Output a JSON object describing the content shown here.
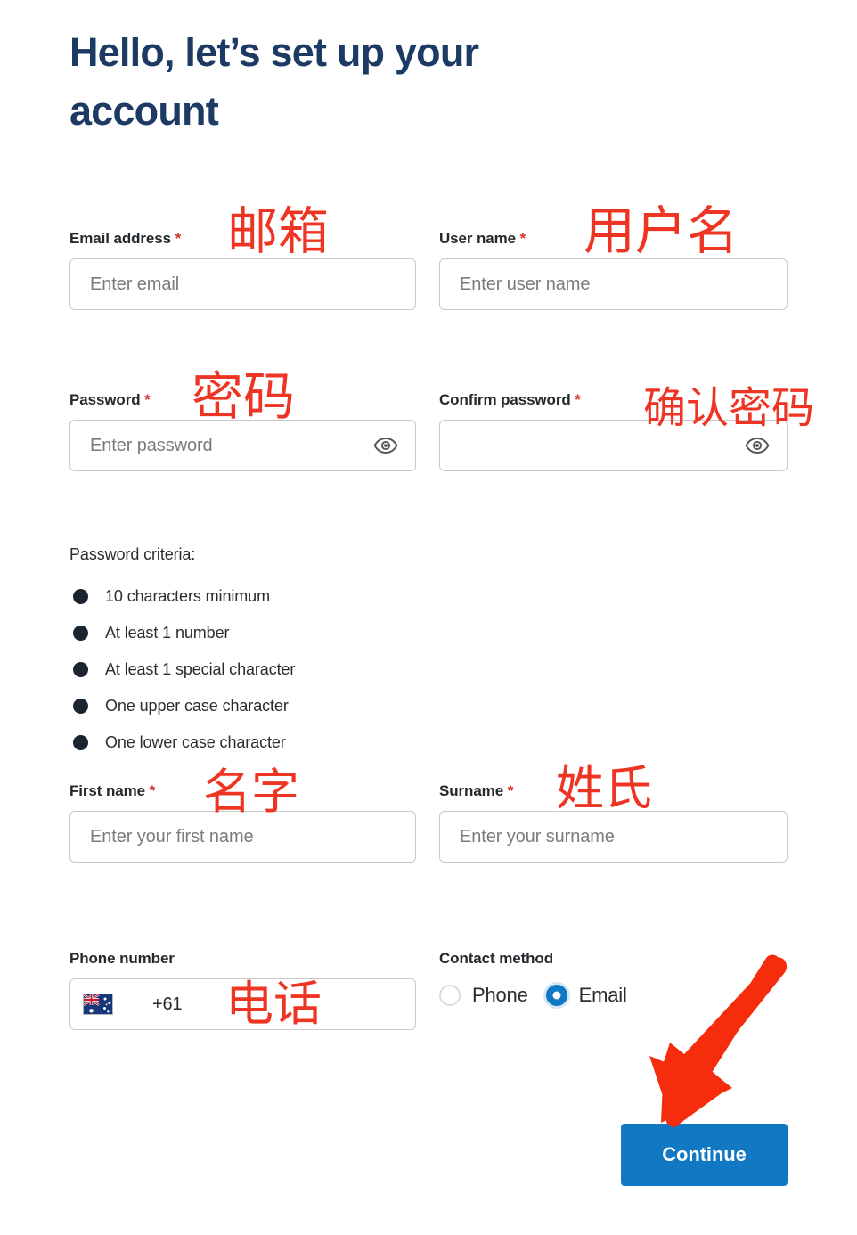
{
  "heading": "Hello, let’s set up your account",
  "fields": {
    "email": {
      "label": "Email address",
      "required_mark": "*",
      "placeholder": "Enter email",
      "annotation": "邮箱"
    },
    "username": {
      "label": "User name",
      "required_mark": "*",
      "placeholder": "Enter user name",
      "annotation": "用户名"
    },
    "password": {
      "label": "Password",
      "required_mark": "*",
      "placeholder": "Enter password",
      "annotation": "密码",
      "icon": "eye-icon"
    },
    "confirm": {
      "label": "Confirm password",
      "required_mark": "*",
      "placeholder": "",
      "annotation": "确认密码",
      "icon": "eye-icon"
    },
    "first_name": {
      "label": "First name",
      "required_mark": "*",
      "placeholder": "Enter your first name",
      "annotation": "名字"
    },
    "surname": {
      "label": "Surname",
      "required_mark": "*",
      "placeholder": "Enter your surname",
      "annotation": "姓氏"
    },
    "phone": {
      "label": "Phone number",
      "required_mark": "",
      "dial_code": "+61",
      "flag": "australia-flag-icon",
      "annotation": "电话"
    }
  },
  "password_criteria": {
    "title": "Password criteria:",
    "items": [
      "10 characters minimum",
      "At least 1 number",
      "At least 1 special character",
      "One upper case character",
      "One lower case character"
    ]
  },
  "contact_method": {
    "label": "Contact method",
    "options": [
      {
        "label": "Phone",
        "selected": false
      },
      {
        "label": "Email",
        "selected": true
      }
    ]
  },
  "actions": {
    "continue_label": "Continue"
  },
  "colors": {
    "heading": "#1c3a63",
    "primary_blue": "#1178c4",
    "annotation_red": "#ee3524",
    "required_red": "#d0342c",
    "input_border": "#c9c9c9",
    "placeholder": "#7b7b7b",
    "criteria_dot": "#1b2430"
  }
}
